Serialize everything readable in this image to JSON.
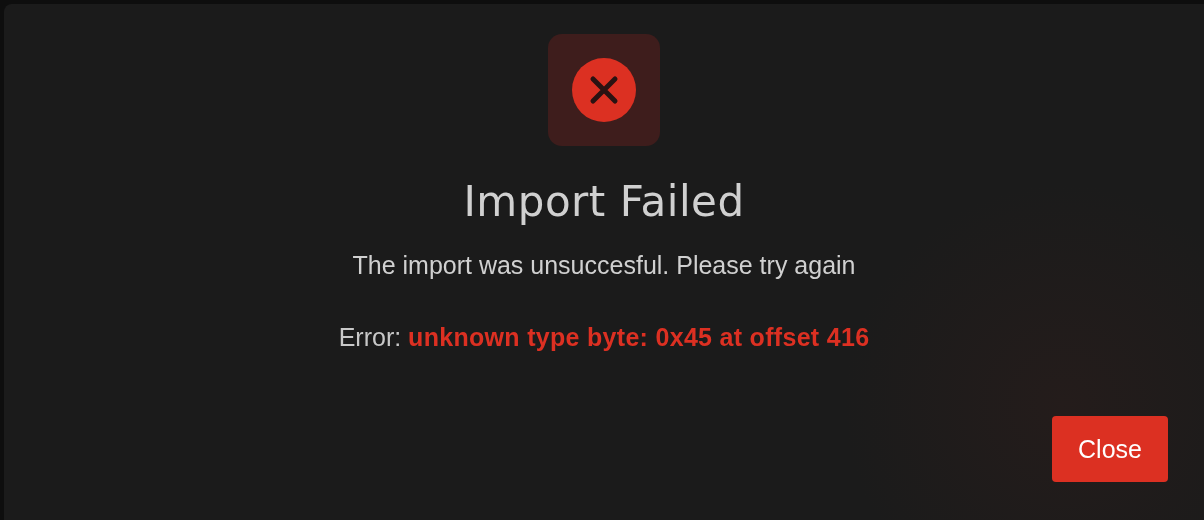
{
  "dialog": {
    "kind": "error",
    "title": "Import Failed",
    "message": "The import was unsuccesful. Please try again",
    "error_label": "Error:",
    "error_text": "unknown type byte: 0x45 at offset 416",
    "buttons": [
      {
        "label": "Close",
        "kind": "primary"
      }
    ]
  }
}
